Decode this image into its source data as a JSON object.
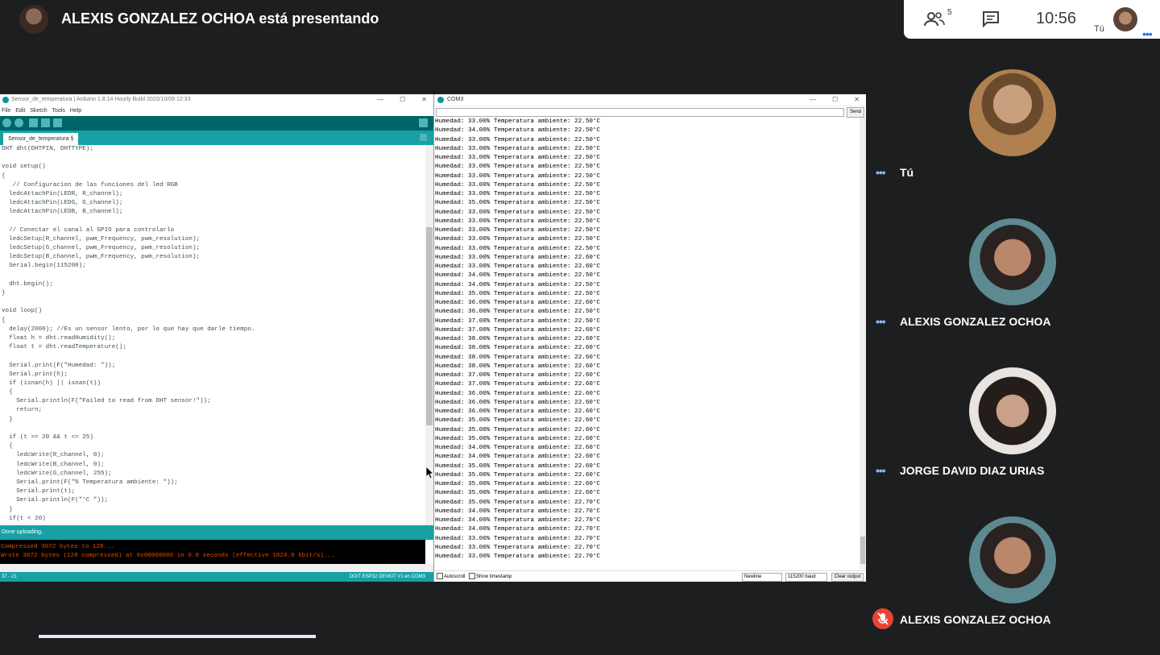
{
  "meet": {
    "presenter_title": "ALEXIS GONZALEZ OCHOA está presentando",
    "people_count": "5",
    "clock": "10:56",
    "me_label": "Tú",
    "participants": [
      {
        "name": "Tú"
      },
      {
        "name": "ALEXIS GONZALEZ OCHOA"
      },
      {
        "name": "JORGE DAVID DIAZ URIAS"
      },
      {
        "name": "ALEXIS GONZALEZ OCHOA"
      }
    ]
  },
  "ide": {
    "title": "Sensor_de_temperatura | Arduino 1.8.14 Hourly Build 2020/10/09 12:33",
    "menu": [
      "File",
      "Edit",
      "Sketch",
      "Tools",
      "Help"
    ],
    "tab": "Sensor_de_temperatura §",
    "code_lines": [
      "DHT dht(DHTPIN, DHTTYPE);",
      "",
      "void setup()",
      "{",
      "   // Configuracion de las funciones del led RGB",
      "  ledcAttachPin(LEDR, R_channel);",
      "  ledcAttachPin(LEDG, G_channel);",
      "  ledcAttachPin(LEDB, B_channel);",
      "",
      "  // Conectar el canal al GPIO para controlarlo",
      "  ledcSetup(R_channel, pwm_Frequency, pwm_resolution);",
      "  ledcSetup(G_channel, pwm_Frequency, pwm_resolution);",
      "  ledcSetup(B_channel, pwm_Frequency, pwm_resolution);",
      "  Serial.begin(115200);",
      "",
      "  dht.begin();",
      "}",
      "",
      "void loop()",
      "{",
      "  delay(2000); //Es un sensor lento, por lo que hay que darle tiempo.",
      "  float h = dht.readHumidity();",
      "  float t = dht.readTemperature();",
      "",
      "  Serial.print(F(\"Humedad: \"));",
      "  Serial.print(h);",
      "  if (isnan(h) || isnan(t))",
      "  {",
      "    Serial.println(F(\"Failed to read from DHT sensor!\"));",
      "    return;",
      "  }",
      "",
      "  if (t >= 20 && t <= 25)",
      "  {",
      "    ledcWrite(R_channel, 0);",
      "    ledcWrite(B_channel, 0);",
      "    ledcWrite(G_channel, 255);",
      "    Serial.print(F(\"% Temperatura ambiente: \"));",
      "    Serial.print(t);",
      "    Serial.println(F(\"°C \"));",
      "  }",
      "  if(t < 20)"
    ],
    "status": "Done uploading.",
    "console_lines": [
      "Compressed 3072 bytes to 128...",
      "Wrote 3072 bytes (128 compressed) at 0x00008000 in 0.0 seconds (effective 1024.0 kbit/s)..."
    ],
    "footer_left": "37 - 21",
    "footer_right": "DOIT ESP32 DEVKIT V1 en COM3"
  },
  "serial": {
    "title": "COM3",
    "send_label": "Send",
    "lines": [
      "Humedad: 33.00% Temperatura ambiente: 22.50°C",
      "Humedad: 34.00% Temperatura ambiente: 22.50°C",
      "Humedad: 33.00% Temperatura ambiente: 22.50°C",
      "Humedad: 33.00% Temperatura ambiente: 22.50°C",
      "Humedad: 33.00% Temperatura ambiente: 22.50°C",
      "Humedad: 33.00% Temperatura ambiente: 22.50°C",
      "Humedad: 33.00% Temperatura ambiente: 22.50°C",
      "Humedad: 33.00% Temperatura ambiente: 22.50°C",
      "Humedad: 33.00% Temperatura ambiente: 22.50°C",
      "Humedad: 35.00% Temperatura ambiente: 22.50°C",
      "Humedad: 33.00% Temperatura ambiente: 22.50°C",
      "Humedad: 33.00% Temperatura ambiente: 22.50°C",
      "Humedad: 33.00% Temperatura ambiente: 22.50°C",
      "Humedad: 33.00% Temperatura ambiente: 22.50°C",
      "Humedad: 33.00% Temperatura ambiente: 22.50°C",
      "Humedad: 33.00% Temperatura ambiente: 22.60°C",
      "Humedad: 33.00% Temperatura ambiente: 22.60°C",
      "Humedad: 34.00% Temperatura ambiente: 22.50°C",
      "Humedad: 34.00% Temperatura ambiente: 22.50°C",
      "Humedad: 35.00% Temperatura ambiente: 22.50°C",
      "Humedad: 36.00% Temperatura ambiente: 22.60°C",
      "Humedad: 36.00% Temperatura ambiente: 22.50°C",
      "Humedad: 37.00% Temperatura ambiente: 22.50°C",
      "Humedad: 37.00% Temperatura ambiente: 22.60°C",
      "Humedad: 38.00% Temperatura ambiente: 22.60°C",
      "Humedad: 38.00% Temperatura ambiente: 22.60°C",
      "Humedad: 38.00% Temperatura ambiente: 22.60°C",
      "Humedad: 38.00% Temperatura ambiente: 22.60°C",
      "Humedad: 37.00% Temperatura ambiente: 22.60°C",
      "Humedad: 37.00% Temperatura ambiente: 22.60°C",
      "Humedad: 36.00% Temperatura ambiente: 22.60°C",
      "Humedad: 36.00% Temperatura ambiente: 22.60°C",
      "Humedad: 36.00% Temperatura ambiente: 22.60°C",
      "Humedad: 35.00% Temperatura ambiente: 22.60°C",
      "Humedad: 35.00% Temperatura ambiente: 22.60°C",
      "Humedad: 35.00% Temperatura ambiente: 22.60°C",
      "Humedad: 34.00% Temperatura ambiente: 22.60°C",
      "Humedad: 34.00% Temperatura ambiente: 22.60°C",
      "Humedad: 35.00% Temperatura ambiente: 22.60°C",
      "Humedad: 35.00% Temperatura ambiente: 22.60°C",
      "Humedad: 35.00% Temperatura ambiente: 22.60°C",
      "Humedad: 35.00% Temperatura ambiente: 22.60°C",
      "Humedad: 35.00% Temperatura ambiente: 22.70°C",
      "Humedad: 34.00% Temperatura ambiente: 22.70°C",
      "Humedad: 34.00% Temperatura ambiente: 22.70°C",
      "Humedad: 34.00% Temperatura ambiente: 22.70°C",
      "Humedad: 33.00% Temperatura ambiente: 22.70°C",
      "Humedad: 33.00% Temperatura ambiente: 22.70°C",
      "Humedad: 33.00% Temperatura ambiente: 22.70°C"
    ],
    "autoscroll_label": "Autoscroll",
    "timestamp_label": "Show timestamp",
    "line_ending": "Newline",
    "baud": "115200 baud",
    "clear_label": "Clear output"
  },
  "colors": {
    "arduino_dark": "#006468",
    "arduino_teal": "#17a1a5",
    "meet_bg": "#1d1e20",
    "mute_red": "#ea4335"
  }
}
